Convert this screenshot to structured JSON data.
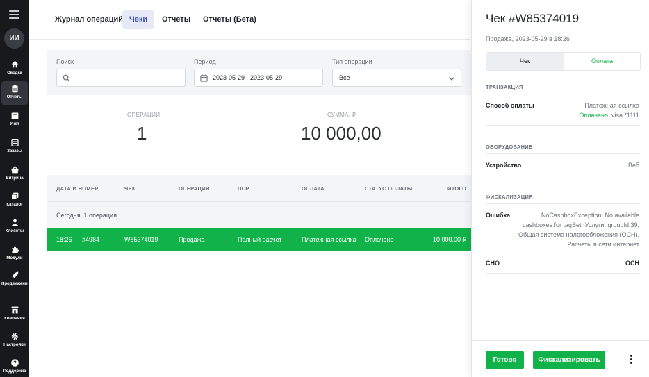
{
  "sidebar": {
    "avatar_initials": "ИИ",
    "items": [
      {
        "label": "Сводка",
        "icon": "home-icon"
      },
      {
        "label": "Отчеты",
        "icon": "clipboard-icon"
      },
      {
        "label": "Учет",
        "icon": "inbox-icon"
      },
      {
        "label": "Заказы",
        "icon": "list-icon"
      },
      {
        "label": "Витрина",
        "icon": "basket-icon"
      },
      {
        "label": "Каталог",
        "icon": "copy-icon"
      },
      {
        "label": "Клиенты",
        "icon": "person-icon"
      },
      {
        "label": "Модули",
        "icon": "puzzle-icon"
      },
      {
        "label": "Продвижение",
        "icon": "rocket-icon"
      },
      {
        "label": "Компания",
        "icon": "store-icon"
      },
      {
        "label": "Настройки",
        "icon": "gear-icon"
      },
      {
        "label": "Поддержка",
        "icon": "help-icon"
      }
    ]
  },
  "tabs": [
    {
      "label": "Журнал операций"
    },
    {
      "label": "Чеки"
    },
    {
      "label": "Отчеты"
    },
    {
      "label": "Отчеты (Бета)"
    }
  ],
  "filters": {
    "search": {
      "label": "Поиск",
      "value": ""
    },
    "period": {
      "label": "Период",
      "value": "2023-05-29 - 2023-05-29"
    },
    "type": {
      "label": "Тип операции",
      "value": "Все"
    }
  },
  "stats": {
    "operations_label": "ОПЕРАЦИИ",
    "operations_value": "1",
    "sum_label": "СУММА, ₽",
    "sum_value": "10 000,00"
  },
  "table": {
    "headers": [
      "ДАТА И НОМЕР",
      "ЧЕК",
      "ОПЕРАЦИЯ",
      "ПСР",
      "ОПЛАТА",
      "СТАТУС ОПЛАТЫ",
      "ИТОГО"
    ],
    "group_label": "Сегодня, 1 операция",
    "row": {
      "time": "18:26",
      "number": "#4984",
      "receipt": "W85374019",
      "operation": "Продажа",
      "psr": "Полный расчет",
      "payment": "Платежная ссылка",
      "status": "Оплачено",
      "total": "10 000,00 ₽"
    }
  },
  "panel": {
    "title": "Чек #W85374019",
    "subtitle": "Продажа, 2023-05-29 в 18:26",
    "segment": [
      "Чек",
      "Оплата"
    ],
    "transaction_header": "ТРАНЗАКЦИЯ",
    "payment_method_key": "Способ оплаты",
    "payment_method_value": "Платежная ссылка",
    "payment_status_paid": "Оплачено",
    "payment_status_card": ", visa *1111",
    "equipment_header": "ОБОРУДОВАНИЕ",
    "device_key": "Устройство",
    "device_value": "Веб",
    "fiscal_header": "ФИСКАЛИЗАЦИЯ",
    "error_key": "Ошибка",
    "error_value": "NoCashboxException: No available cashboxes for tagSet=Услуги, groupId.39, Общая система налогообложения (ОСН), Расчеты в сети интернет",
    "sno_key": "СНО",
    "sno_value": "ОСН",
    "done_button": "Готово",
    "fiscalize_button": "Фискализировать"
  },
  "colors": {
    "accent_green": "#12b24a",
    "sidebar_bg": "#17191c",
    "tab_active_bg": "#e7e9f7",
    "tab_active_text": "#3f51b5"
  }
}
